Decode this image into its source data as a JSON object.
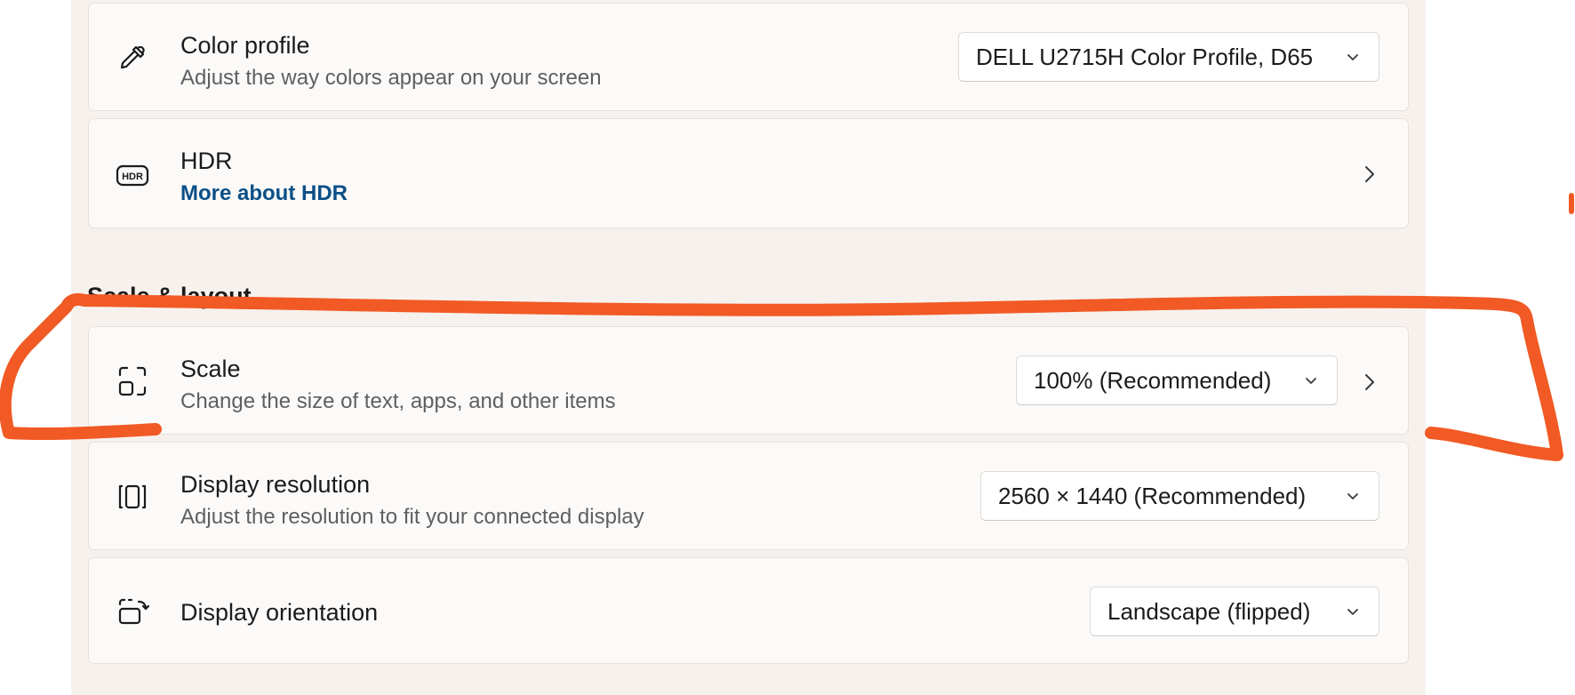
{
  "accent_color": "#0b4f86",
  "annotation_color": "#f15a24",
  "settings": {
    "color_profile": {
      "icon": "eyedropper-icon",
      "title": "Color profile",
      "subtitle": "Adjust the way colors appear on your screen",
      "value": "DELL U2715H Color Profile, D65"
    },
    "hdr": {
      "icon": "hdr-icon",
      "title": "HDR",
      "link": "More about HDR"
    },
    "section_title": "Scale & layout",
    "scale": {
      "icon": "scale-icon",
      "title": "Scale",
      "subtitle": "Change the size of text, apps, and other items",
      "value": "100% (Recommended)"
    },
    "resolution": {
      "icon": "resolution-icon",
      "title": "Display resolution",
      "subtitle": "Adjust the resolution to fit your connected display",
      "value": "2560 × 1440 (Recommended)"
    },
    "orientation": {
      "icon": "rotate-screen-icon",
      "title": "Display orientation",
      "value": "Landscape (flipped)"
    }
  }
}
